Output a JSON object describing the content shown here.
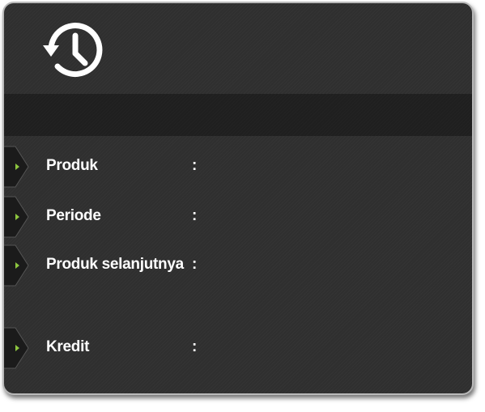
{
  "header": {
    "icon": "history-icon"
  },
  "fields": {
    "produk": {
      "label": "Produk",
      "colon": ":",
      "value": ""
    },
    "periode": {
      "label": "Periode",
      "colon": ":",
      "value": ""
    },
    "produk_selanjutnya": {
      "label": "Produk selanjutnya",
      "colon": ":",
      "value": ""
    },
    "kredit": {
      "label": "Kredit",
      "colon": ":",
      "value": ""
    }
  },
  "colors": {
    "panel_background": "#2f2f2f",
    "band_background": "#1f1f1f",
    "border": "#b9b9b9",
    "arrow_accent": "#8dc63f",
    "text": "#ffffff"
  }
}
